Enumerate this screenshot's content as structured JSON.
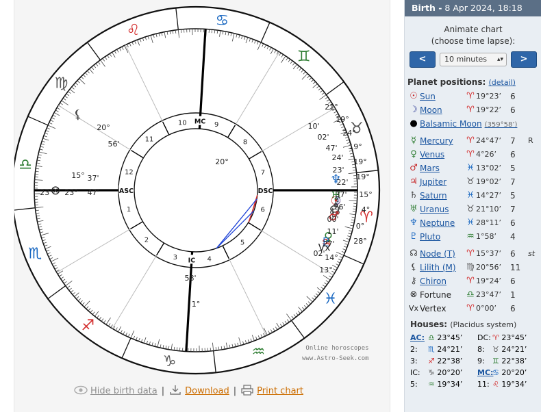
{
  "chart": {
    "ascendant_label": "ASC",
    "descendant_label": "DSC",
    "mc_label": "MC",
    "ic_label": "IC",
    "cusp_numbers": [
      "1",
      "2",
      "3",
      "4",
      "5",
      "6",
      "7",
      "8",
      "9",
      "10",
      "11",
      "12"
    ],
    "wheel_labels": [
      {
        "t": "20°",
        "c": "#222"
      },
      {
        "t": "21°",
        "c": "#222"
      },
      {
        "t": "19°",
        "c": "#222"
      },
      {
        "t": "24°",
        "c": "#222"
      },
      {
        "t": "10'",
        "c": "#222"
      },
      {
        "t": "02'",
        "c": "#222"
      },
      {
        "t": "47'",
        "c": "#222"
      },
      {
        "t": "19°",
        "c": "#222"
      },
      {
        "t": "24'",
        "c": "#222"
      },
      {
        "t": "23'",
        "c": "#222"
      },
      {
        "t": "19°",
        "c": "#222"
      },
      {
        "t": "22'",
        "c": "#222"
      },
      {
        "t": "19°",
        "c": "#222"
      },
      {
        "t": "37'",
        "c": "#222"
      },
      {
        "t": "15°",
        "c": "#222"
      },
      {
        "t": "26'",
        "c": "#222"
      },
      {
        "t": "4°",
        "c": "#222"
      },
      {
        "t": "00'",
        "c": "#222"
      },
      {
        "t": "0°",
        "c": "#222"
      },
      {
        "t": "11'",
        "c": "#222"
      },
      {
        "t": "28°",
        "c": "#222"
      },
      {
        "t": "27'",
        "c": "#222"
      },
      {
        "t": "02'",
        "c": "#222"
      },
      {
        "t": "14°",
        "c": "#222"
      },
      {
        "t": "13°",
        "c": "#222"
      },
      {
        "t": "58'",
        "c": "#222"
      },
      {
        "t": "1°",
        "c": "#222"
      },
      {
        "t": "20°",
        "c": "#222"
      },
      {
        "t": "56'",
        "c": "#222"
      },
      {
        "t": "15°",
        "c": "#222"
      },
      {
        "t": "37'",
        "c": "#222"
      },
      {
        "t": "23°",
        "c": "#222"
      },
      {
        "t": "47'",
        "c": "#222"
      },
      {
        "t": "23°",
        "c": "#222"
      }
    ],
    "watermark_line1": "Online horoscopes",
    "watermark_line2": "www.Astro-Seek.com"
  },
  "links": {
    "hide": "Hide birth data",
    "download": "Download",
    "print": "Print chart"
  },
  "sidebar": {
    "birth_label": "Birth -",
    "birth_date": "8 Apr 2024, 18:18",
    "animate_line1": "Animate chart",
    "animate_line2": "(choose time lapse):",
    "prev": "<",
    "next": ">",
    "lapse_value": "10 minutes",
    "planets_title": "Planet positions:",
    "detail_link": "(detail)",
    "planets": [
      {
        "glyph": "☉",
        "gc": "#c62828",
        "name": "Sun",
        "sign": "♈",
        "sc": "#d32f2f",
        "deg": "19°23’",
        "house": "6",
        "retro": ""
      },
      {
        "glyph": "☽",
        "gc": "#283593",
        "name": "Moon",
        "sign": "♈",
        "sc": "#d32f2f",
        "deg": "19°22’",
        "house": "6",
        "retro": ""
      },
      {
        "glyph": "●",
        "gc": "#000000",
        "name": "Balsamic Moon",
        "deg2": "(359°58’)"
      },
      {
        "glyph": "☿",
        "gc": "#2e7d32",
        "name": "Mercury",
        "sign": "♈",
        "sc": "#d32f2f",
        "deg": "24°47’",
        "house": "7",
        "retro": "R"
      },
      {
        "glyph": "♀",
        "gc": "#2e7d32",
        "name": "Venus",
        "sign": "♈",
        "sc": "#d32f2f",
        "deg": "4°26’",
        "house": "6",
        "retro": ""
      },
      {
        "glyph": "♂",
        "gc": "#c62828",
        "name": "Mars",
        "sign": "♓",
        "sc": "#1565c0",
        "deg": "13°02’",
        "house": "5",
        "retro": ""
      },
      {
        "glyph": "♃",
        "gc": "#c62828",
        "name": "Jupiter",
        "sign": "♉",
        "sc": "#555555",
        "deg": "19°02’",
        "house": "7",
        "retro": ""
      },
      {
        "glyph": "♄",
        "gc": "#444444",
        "name": "Saturn",
        "sign": "♓",
        "sc": "#1565c0",
        "deg": "14°27’",
        "house": "5",
        "retro": ""
      },
      {
        "glyph": "♅",
        "gc": "#2e7d32",
        "name": "Uranus",
        "sign": "♉",
        "sc": "#555555",
        "deg": "21°10’",
        "house": "7",
        "retro": ""
      },
      {
        "glyph": "♆",
        "gc": "#1565c0",
        "name": "Neptune",
        "sign": "♓",
        "sc": "#1565c0",
        "deg": "28°11’",
        "house": "6",
        "retro": ""
      },
      {
        "glyph": "♇",
        "gc": "#1565c0",
        "name": "Pluto",
        "sign": "♒",
        "sc": "#2e7d32",
        "deg": "1°58’",
        "house": "4",
        "retro": ""
      },
      {
        "glyph": "☊",
        "gc": "#444444",
        "name": "Node (T)",
        "sign": "♈",
        "sc": "#d32f2f",
        "deg": "15°37’",
        "house": "6",
        "retro": "st"
      },
      {
        "glyph": "⚸",
        "gc": "#444444",
        "name": "Lilith (M)",
        "sign": "♍",
        "sc": "#555555",
        "deg": "20°56’",
        "house": "11",
        "retro": ""
      },
      {
        "glyph": "⚷",
        "gc": "#444444",
        "name": "Chiron",
        "sign": "♈",
        "sc": "#d32f2f",
        "deg": "19°24’",
        "house": "6",
        "retro": ""
      },
      {
        "glyph": "⊗",
        "gc": "#222222",
        "name": "Fortune",
        "sign": "♎",
        "sc": "#2e7d32",
        "deg": "23°47’",
        "house": "1",
        "retro": ""
      },
      {
        "glyph": "Vx",
        "gc": "#222222",
        "name": "Vertex",
        "sign": "♈",
        "sc": "#d32f2f",
        "deg": "0°00’",
        "house": "6",
        "retro": ""
      }
    ],
    "houses_title": "Houses:",
    "houses_system": "(Placidus system)",
    "houses": [
      {
        "l": "AC:",
        "s": "♎",
        "sc": "#2e7d32",
        "v": "23°45’",
        "l2": "DC:",
        "s2": "♈",
        "sc2": "#d32f2f",
        "v2": "23°45’"
      },
      {
        "l": "2:",
        "s": "♏",
        "sc": "#1565c0",
        "v": "24°21’",
        "l2": "8:",
        "s2": "♉",
        "sc2": "#555555",
        "v2": "24°21’"
      },
      {
        "l": "3:",
        "s": "♐",
        "sc": "#d32f2f",
        "v": "22°38’",
        "l2": "9:",
        "s2": "♊",
        "sc2": "#2e7d32",
        "v2": "22°38’"
      },
      {
        "l": "IC:",
        "s": "♑",
        "sc": "#555555",
        "v": "20°20’",
        "l2": "MC:",
        "s2": "♋",
        "sc2": "#1565c0",
        "v2": "20°20’"
      },
      {
        "l": "5:",
        "s": "♒",
        "sc": "#2e7d32",
        "v": "19°34’",
        "l2": "11:",
        "s2": "♌",
        "sc2": "#d32f2f",
        "v2": "19°34’"
      }
    ]
  },
  "colors": {
    "fire": "#d32f2f",
    "earth": "#555555",
    "air": "#2e7d32",
    "water": "#1565c0",
    "aspect_red": "#d32f2f",
    "aspect_blue": "#1a3fd6"
  }
}
